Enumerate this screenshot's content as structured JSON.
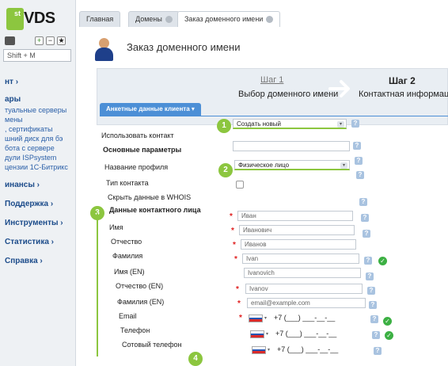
{
  "sidebar": {
    "logo_sup": "st",
    "logo_text": "VDS",
    "search_value": "Shift + M",
    "items": [
      {
        "label": "нт ›",
        "bold": true
      },
      {
        "label": "ары",
        "bold": true
      },
      {
        "label": "туальные серверы"
      },
      {
        "label": "мены"
      },
      {
        "label": ", сертификаты"
      },
      {
        "label": "шний диск для бэ"
      },
      {
        "label": "бота с сервере"
      },
      {
        "label": "дули ISPsystem"
      },
      {
        "label": "цензии 1С-Битрикс"
      },
      {
        "label": "инансы ›",
        "bold": true
      },
      {
        "label": "Поддержка ›",
        "bold": true
      },
      {
        "label": "Инструменты ›",
        "bold": true
      },
      {
        "label": "Статистика ›",
        "bold": true
      },
      {
        "label": "Справка ›",
        "bold": true
      }
    ]
  },
  "tabs": [
    {
      "label": "Главная"
    },
    {
      "label": "Домены"
    },
    {
      "label": "Заказ доменного имени"
    }
  ],
  "page": {
    "title": "Заказ доменного имени"
  },
  "steps": {
    "step1_num": "Шаг 1",
    "step1_text": "Выбор доменного имени",
    "step2_num": "Шаг 2",
    "step2_text": "Контактная информаци"
  },
  "section": {
    "label": "Анкетные данные клиента"
  },
  "badges": [
    "1",
    "2",
    "3",
    "4"
  ],
  "form": {
    "use_contact_label": "Использовать контакт",
    "use_contact_value": "Создать новый",
    "basic_params_label": "Основные параметры",
    "profile_name_label": "Название профиля",
    "contact_type_label": "Тип контакта",
    "contact_type_value": "Физическое лицо",
    "hide_whois_label": "Скрыть данные в WHOIS",
    "contact_data_label": "Данные контактного лица",
    "first_name_label": "Имя",
    "first_name_value": "Иван",
    "middle_name_label": "Отчество",
    "middle_name_value": "Иванович",
    "last_name_label": "Фамилия",
    "last_name_value": "Иванов",
    "first_name_en_label": "Имя (EN)",
    "first_name_en_value": "Ivan",
    "middle_name_en_label": "Отчество (EN)",
    "middle_name_en_value": "Ivanovich",
    "last_name_en_label": "Фамилия (EN)",
    "last_name_en_value": "Ivanov",
    "email_label": "Email",
    "email_placeholder": "email@example.com",
    "phone_label": "Телефон",
    "phone_value": "+7 (___) ___-__-__",
    "mobile_label": "Сотовый телефон",
    "mobile_value": "+7 (___) ___-__-__",
    "fax_value": "+7 (___) ___-__-__",
    "required_mark": "*",
    "help_mark": "?",
    "ok_mark": "✓",
    "caret": "▾"
  },
  "colors": {
    "accent_green": "#8cc63f",
    "section_blue": "#4c8fd6",
    "required_red": "#e02020",
    "ok_green": "#3cb043"
  }
}
